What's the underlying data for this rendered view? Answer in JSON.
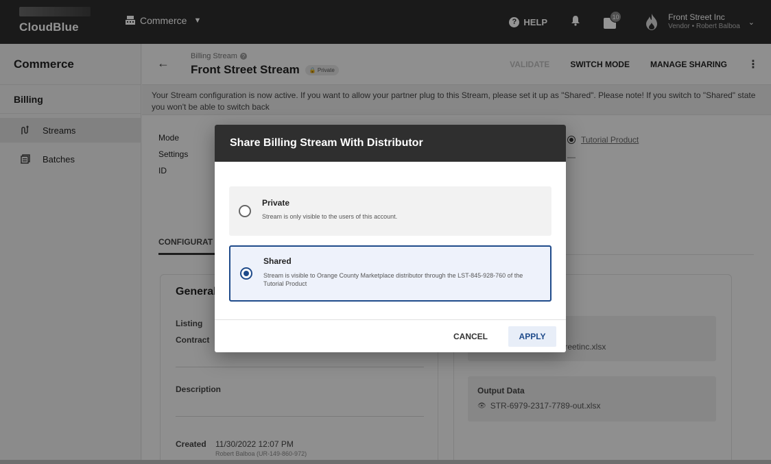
{
  "topbar": {
    "logo_text": "CloudBlue",
    "module": "Commerce",
    "help": "HELP",
    "notifications_count": "10",
    "account_name": "Front Street Inc",
    "account_sub": "Vendor • Robert Balboa"
  },
  "sidebar": {
    "module_title": "Commerce",
    "section_title": "Billing",
    "items": [
      {
        "label": "Streams",
        "icon": "streams-icon",
        "active": true
      },
      {
        "label": "Batches",
        "icon": "batches-icon",
        "active": false
      }
    ]
  },
  "header": {
    "breadcrumb": "Billing Stream",
    "title": "Front Street Stream",
    "status_chip": "Private",
    "actions": {
      "validate": "VALIDATE",
      "switch_mode": "SWITCH MODE",
      "manage_sharing": "MANAGE SHARING"
    }
  },
  "alert": {
    "text": "Your Stream configuration is now active. If you want to allow your partner plug to this Stream, please set it up as \"Shared\". Please note! If you switch to \"Shared\" state you won't be able to switch back"
  },
  "details": {
    "mode_label": "Mode",
    "settings_label": "Settings",
    "id_label": "ID",
    "product_link": "Tutorial Product",
    "settings_value": "—"
  },
  "tabs": {
    "configuration": "CONFIGURAT"
  },
  "general_card": {
    "title": "General",
    "listing_label": "Listing",
    "contract_label": "Contract",
    "description_label": "Description",
    "created_label": "Created",
    "created_value": "11/30/2022 12:07 PM",
    "created_by": "Robert Balboa (UR-149-860-972)"
  },
  "files_card": {
    "input_file_partial": "treetinc.xlsx",
    "output_label": "Output Data",
    "output_file": "STR-6979-2317-7789-out.xlsx"
  },
  "dialog": {
    "title": "Share Billing Stream With Distributor",
    "options": [
      {
        "title": "Private",
        "description": "Stream is only visible to the users of this account.",
        "selected": false
      },
      {
        "title": "Shared",
        "description": "Stream is visible to Orange County Marketplace distributor through the LST-845-928-760 of the Tutorial Product",
        "selected": true
      }
    ],
    "cancel": "CANCEL",
    "apply": "APPLY"
  }
}
